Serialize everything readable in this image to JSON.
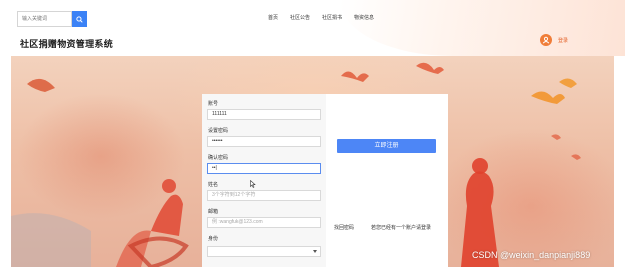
{
  "header": {
    "search_placeholder": "输入关键词",
    "nav": [
      "首页",
      "社区公告",
      "社区捐书",
      "物资信息"
    ],
    "site_title": "社区捐赠物资管理系统",
    "login_label": "登录",
    "accent": "#3b82f6",
    "login_color": "#f07d38"
  },
  "form": {
    "account_label": "账号",
    "account_value": "111111",
    "password_label": "设置密码",
    "password_value": "••••••",
    "confirm_label": "确认密码",
    "confirm_value": "••|",
    "name_label": "姓名",
    "name_placeholder": "3个字符到12个字符",
    "email_label": "邮箱",
    "email_placeholder": "例 :wangfuk@123.com",
    "identity_label": "身份",
    "register_button": "立即注册",
    "forgot_link": "找回密码",
    "login_link": "若您已经有一个账户请登录"
  },
  "watermark": "CSDN @weixin_danpianji889"
}
